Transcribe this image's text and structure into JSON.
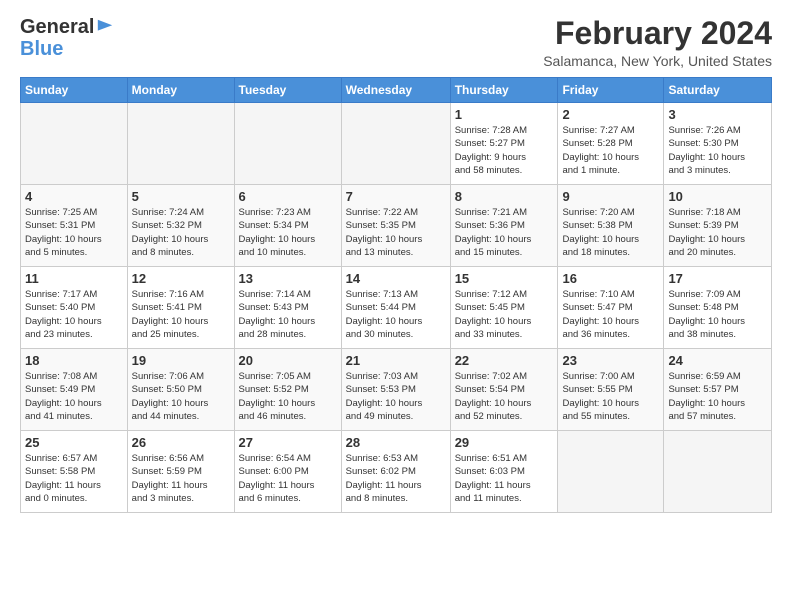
{
  "logo": {
    "line1": "General",
    "line2": "Blue"
  },
  "header": {
    "title": "February 2024",
    "location": "Salamanca, New York, United States"
  },
  "weekdays": [
    "Sunday",
    "Monday",
    "Tuesday",
    "Wednesday",
    "Thursday",
    "Friday",
    "Saturday"
  ],
  "weeks": [
    [
      {
        "day": "",
        "info": ""
      },
      {
        "day": "",
        "info": ""
      },
      {
        "day": "",
        "info": ""
      },
      {
        "day": "",
        "info": ""
      },
      {
        "day": "1",
        "info": "Sunrise: 7:28 AM\nSunset: 5:27 PM\nDaylight: 9 hours\nand 58 minutes."
      },
      {
        "day": "2",
        "info": "Sunrise: 7:27 AM\nSunset: 5:28 PM\nDaylight: 10 hours\nand 1 minute."
      },
      {
        "day": "3",
        "info": "Sunrise: 7:26 AM\nSunset: 5:30 PM\nDaylight: 10 hours\nand 3 minutes."
      }
    ],
    [
      {
        "day": "4",
        "info": "Sunrise: 7:25 AM\nSunset: 5:31 PM\nDaylight: 10 hours\nand 5 minutes."
      },
      {
        "day": "5",
        "info": "Sunrise: 7:24 AM\nSunset: 5:32 PM\nDaylight: 10 hours\nand 8 minutes."
      },
      {
        "day": "6",
        "info": "Sunrise: 7:23 AM\nSunset: 5:34 PM\nDaylight: 10 hours\nand 10 minutes."
      },
      {
        "day": "7",
        "info": "Sunrise: 7:22 AM\nSunset: 5:35 PM\nDaylight: 10 hours\nand 13 minutes."
      },
      {
        "day": "8",
        "info": "Sunrise: 7:21 AM\nSunset: 5:36 PM\nDaylight: 10 hours\nand 15 minutes."
      },
      {
        "day": "9",
        "info": "Sunrise: 7:20 AM\nSunset: 5:38 PM\nDaylight: 10 hours\nand 18 minutes."
      },
      {
        "day": "10",
        "info": "Sunrise: 7:18 AM\nSunset: 5:39 PM\nDaylight: 10 hours\nand 20 minutes."
      }
    ],
    [
      {
        "day": "11",
        "info": "Sunrise: 7:17 AM\nSunset: 5:40 PM\nDaylight: 10 hours\nand 23 minutes."
      },
      {
        "day": "12",
        "info": "Sunrise: 7:16 AM\nSunset: 5:41 PM\nDaylight: 10 hours\nand 25 minutes."
      },
      {
        "day": "13",
        "info": "Sunrise: 7:14 AM\nSunset: 5:43 PM\nDaylight: 10 hours\nand 28 minutes."
      },
      {
        "day": "14",
        "info": "Sunrise: 7:13 AM\nSunset: 5:44 PM\nDaylight: 10 hours\nand 30 minutes."
      },
      {
        "day": "15",
        "info": "Sunrise: 7:12 AM\nSunset: 5:45 PM\nDaylight: 10 hours\nand 33 minutes."
      },
      {
        "day": "16",
        "info": "Sunrise: 7:10 AM\nSunset: 5:47 PM\nDaylight: 10 hours\nand 36 minutes."
      },
      {
        "day": "17",
        "info": "Sunrise: 7:09 AM\nSunset: 5:48 PM\nDaylight: 10 hours\nand 38 minutes."
      }
    ],
    [
      {
        "day": "18",
        "info": "Sunrise: 7:08 AM\nSunset: 5:49 PM\nDaylight: 10 hours\nand 41 minutes."
      },
      {
        "day": "19",
        "info": "Sunrise: 7:06 AM\nSunset: 5:50 PM\nDaylight: 10 hours\nand 44 minutes."
      },
      {
        "day": "20",
        "info": "Sunrise: 7:05 AM\nSunset: 5:52 PM\nDaylight: 10 hours\nand 46 minutes."
      },
      {
        "day": "21",
        "info": "Sunrise: 7:03 AM\nSunset: 5:53 PM\nDaylight: 10 hours\nand 49 minutes."
      },
      {
        "day": "22",
        "info": "Sunrise: 7:02 AM\nSunset: 5:54 PM\nDaylight: 10 hours\nand 52 minutes."
      },
      {
        "day": "23",
        "info": "Sunrise: 7:00 AM\nSunset: 5:55 PM\nDaylight: 10 hours\nand 55 minutes."
      },
      {
        "day": "24",
        "info": "Sunrise: 6:59 AM\nSunset: 5:57 PM\nDaylight: 10 hours\nand 57 minutes."
      }
    ],
    [
      {
        "day": "25",
        "info": "Sunrise: 6:57 AM\nSunset: 5:58 PM\nDaylight: 11 hours\nand 0 minutes."
      },
      {
        "day": "26",
        "info": "Sunrise: 6:56 AM\nSunset: 5:59 PM\nDaylight: 11 hours\nand 3 minutes."
      },
      {
        "day": "27",
        "info": "Sunrise: 6:54 AM\nSunset: 6:00 PM\nDaylight: 11 hours\nand 6 minutes."
      },
      {
        "day": "28",
        "info": "Sunrise: 6:53 AM\nSunset: 6:02 PM\nDaylight: 11 hours\nand 8 minutes."
      },
      {
        "day": "29",
        "info": "Sunrise: 6:51 AM\nSunset: 6:03 PM\nDaylight: 11 hours\nand 11 minutes."
      },
      {
        "day": "",
        "info": ""
      },
      {
        "day": "",
        "info": ""
      }
    ]
  ],
  "colors": {
    "header_bg": "#4a90d9",
    "accent": "#4a90d9"
  }
}
